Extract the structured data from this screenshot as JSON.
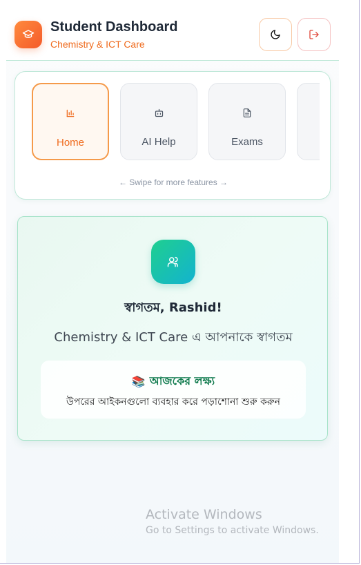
{
  "header": {
    "title": "Student Dashboard",
    "subtitle": "Chemistry & ICT Care",
    "logo_icon": "graduation-cap-icon",
    "theme_icon": "moon-icon",
    "logout_icon": "logout-icon"
  },
  "features": {
    "tiles": [
      {
        "label": "Home",
        "icon": "bar-chart-icon",
        "active": true
      },
      {
        "label": "AI Help",
        "icon": "robot-icon",
        "active": false
      },
      {
        "label": "Exams",
        "icon": "document-icon",
        "active": false
      },
      {
        "label": "",
        "icon": "",
        "active": false
      }
    ],
    "hint": "← Swipe for more features →"
  },
  "welcome": {
    "icon": "users-icon",
    "title": "স্বাগতম, Rashid!",
    "subtitle": "Chemistry & ICT Care এ আপনাকে স্বাগতম",
    "goal_emoji": "📚",
    "goal_title": "আজকের লক্ষ্য",
    "goal_text": "উপরের আইকনগুলো ব্যবহার করে পড়াশোনা শুরু করুন"
  },
  "watermark": {
    "title": "Activate Windows",
    "subtitle": "Go to Settings to activate Windows."
  },
  "colors": {
    "accent_orange": "#ef6a1c",
    "accent_green": "#0f7a4d",
    "card_border": "#bfe8d8"
  }
}
